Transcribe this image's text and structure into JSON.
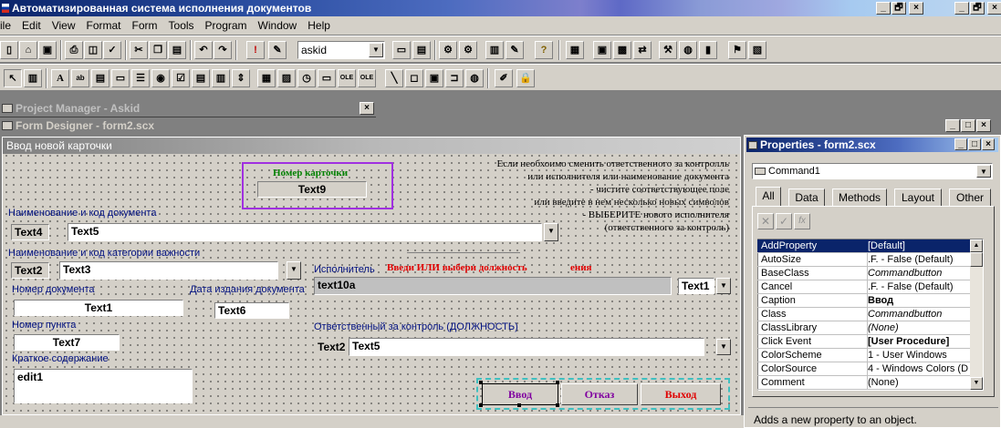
{
  "app": {
    "title": "Автоматизированная система исполнения документов",
    "caption_min": "_",
    "caption_max": "🗗",
    "caption_close": "×"
  },
  "menu": [
    "ile",
    "Edit",
    "View",
    "Format",
    "Form",
    "Tools",
    "Program",
    "Window",
    "Help"
  ],
  "toolbar": {
    "combo_value": "askid"
  },
  "project_manager": {
    "title": "Project Manager - Askid",
    "close": "×"
  },
  "form_designer": {
    "title": "Form Designer - form2.scx"
  },
  "form": {
    "caption": "Ввод новой карточки",
    "card_number_label": "Номер карточки",
    "text9": "Text9",
    "note_lines": [
      "Если необхоимо сменить ответственного за контролль",
      "или исполнителя или наименование документа",
      "- чистите соответствующее поле",
      "или введите в нем несколько новых символов",
      "- ВЫБЕРИТЕ нового исполнителя",
      "(ответственного за контроль)"
    ],
    "doc_name_label": "Наименование и код документа",
    "text4": "Text4",
    "text5a": "Text5",
    "category_label": "Наименование и код категории важности",
    "text2a": "Text2",
    "text3": "Text3",
    "doc_number_label": "Номер документа",
    "text1a": "Text1",
    "date_label": "Дата издания документа",
    "text6": "Text6",
    "item_number_label": "Номер пункта",
    "text7": "Text7",
    "summary_label": "Краткое содержание",
    "edit1": "edit1",
    "executor_label": "Исполнитель",
    "executor_hint": "Введи ИЛИ выбери должность",
    "executor_hint2": "ения",
    "text10a": "text10a",
    "text1b": "Text1",
    "responsible_label": "Ответственный за контроль (ДОЛЖНОСТЬ)",
    "text2b": "Text2",
    "text5b": "Text5",
    "btn_enter": "Ввод",
    "btn_cancel": "Отказ",
    "btn_exit": "Выход"
  },
  "properties": {
    "title": "Properties - form2.scx",
    "object": "Command1",
    "tabs": [
      "All",
      "Data",
      "Methods",
      "Layout",
      "Other"
    ],
    "rows": [
      {
        "name": "AddProperty",
        "value": "[Default]",
        "style": "sel"
      },
      {
        "name": "AutoSize",
        "value": ".F. - False (Default)",
        "style": ""
      },
      {
        "name": "BaseClass",
        "value": "Commandbutton",
        "style": "it"
      },
      {
        "name": "Cancel",
        "value": ".F. - False (Default)",
        "style": ""
      },
      {
        "name": "Caption",
        "value": "Ввод",
        "style": "b"
      },
      {
        "name": "Class",
        "value": "Commandbutton",
        "style": "it"
      },
      {
        "name": "ClassLibrary",
        "value": "(None)",
        "style": "it"
      },
      {
        "name": "Click Event",
        "value": "[User Procedure]",
        "style": "b"
      },
      {
        "name": "ColorScheme",
        "value": "1 - User Windows",
        "style": ""
      },
      {
        "name": "ColorSource",
        "value": "4 - Windows Colors (Def",
        "style": ""
      },
      {
        "name": "Comment",
        "value": "(None)",
        "style": ""
      }
    ],
    "status": "Adds a new property to an object."
  }
}
